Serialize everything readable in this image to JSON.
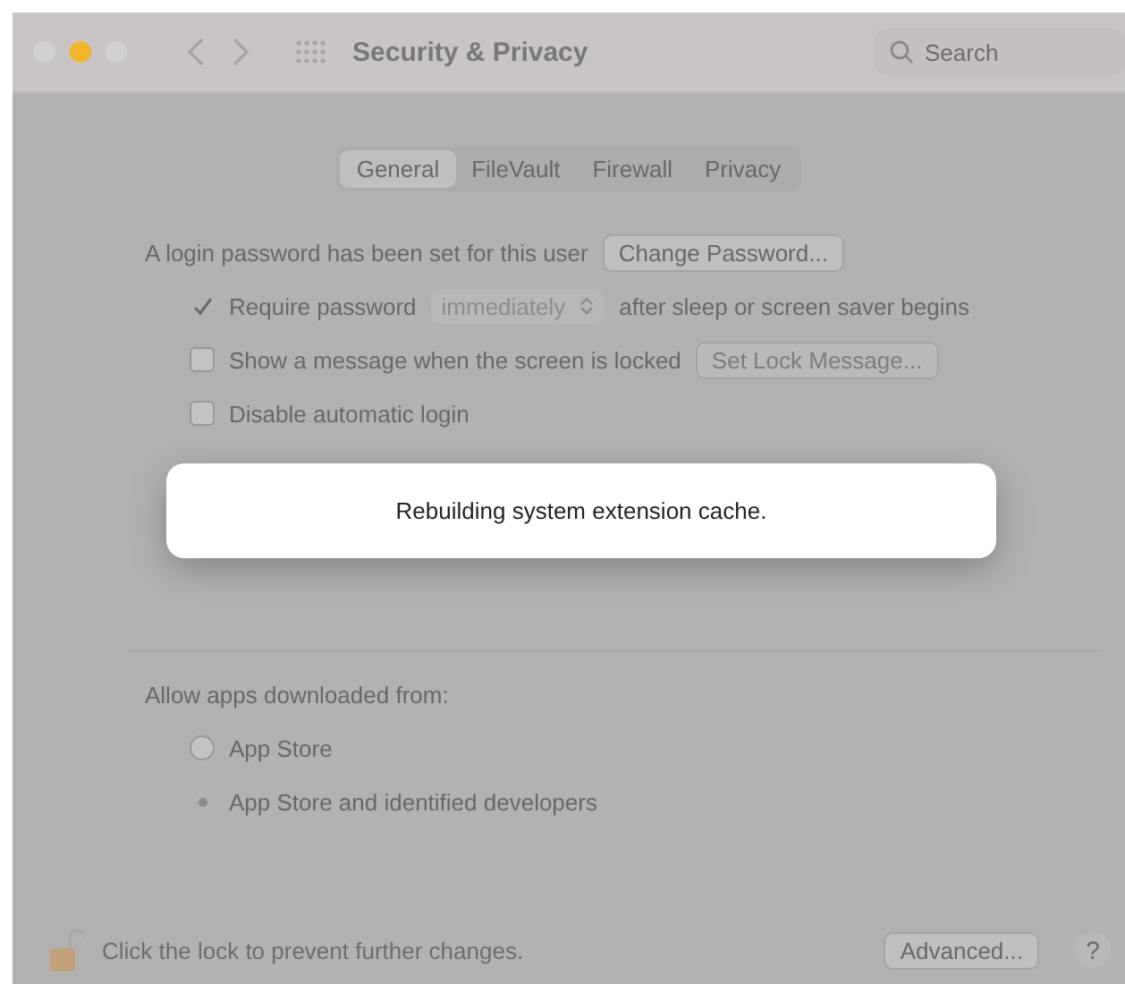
{
  "window": {
    "title": "Security & Privacy",
    "search": {
      "placeholder": "Search"
    }
  },
  "tabs": [
    {
      "label": "General",
      "selected": true
    },
    {
      "label": "FileVault",
      "selected": false
    },
    {
      "label": "Firewall",
      "selected": false
    },
    {
      "label": "Privacy",
      "selected": false
    }
  ],
  "login": {
    "text": "A login password has been set for this user",
    "button": "Change Password..."
  },
  "options": [
    {
      "kind": "require",
      "label": "Require password",
      "checked": true,
      "popup": "immediately",
      "suffix": "after sleep or screen saver begins"
    },
    {
      "kind": "message",
      "label": "Show a message when the screen is locked",
      "checked": false,
      "button": "Set Lock Message...",
      "disabled": true
    },
    {
      "kind": "plain",
      "label": "Disable automatic login",
      "checked": false
    }
  ],
  "allow": {
    "heading": "Allow apps downloaded from:",
    "choices": [
      {
        "label": "App Store",
        "selected": false
      },
      {
        "label": "App Store and identified developers",
        "selected": true
      }
    ]
  },
  "footer": {
    "lock_text": "Click the lock to prevent further changes.",
    "advanced": "Advanced...",
    "help": "?"
  },
  "alert": {
    "message": "Rebuilding system extension cache."
  }
}
